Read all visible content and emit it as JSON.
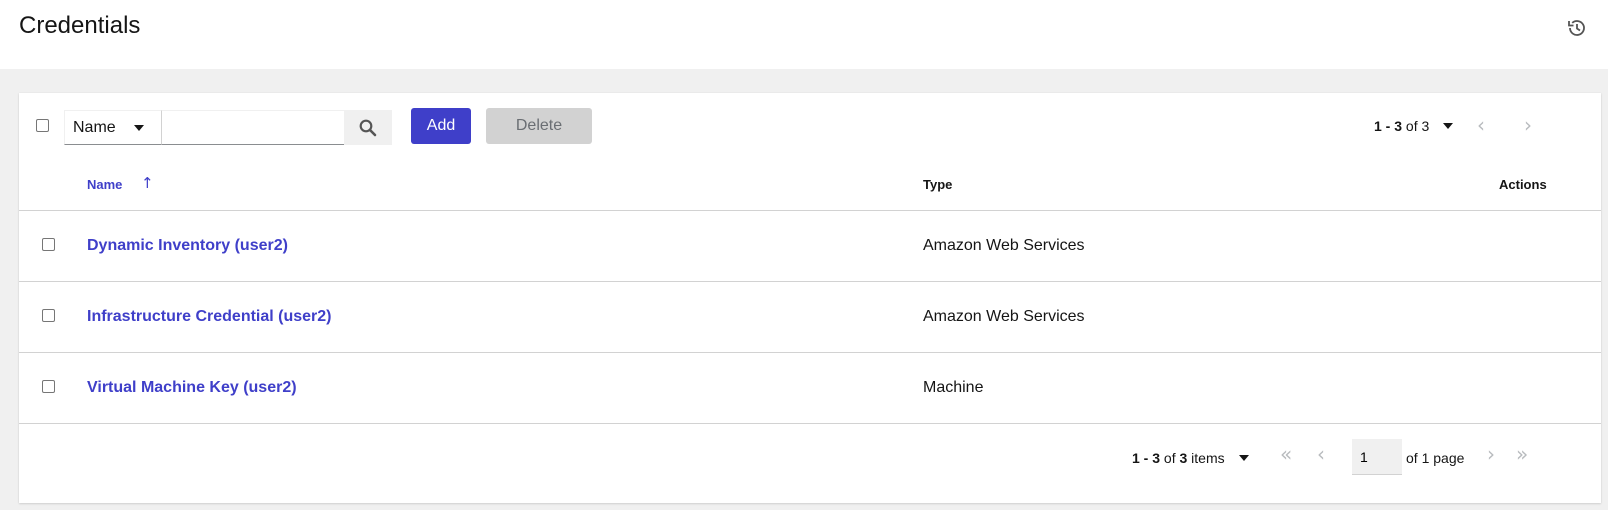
{
  "header": {
    "title": "Credentials",
    "history_icon": "history-icon"
  },
  "toolbar": {
    "filter_field": "Name",
    "search_value": "",
    "search_icon": "search-icon",
    "add_label": "Add",
    "delete_label": "Delete",
    "pagination": {
      "range": "1 - 3",
      "of_label": "of",
      "total": "3",
      "prev_icon": "chevron-left-icon",
      "next_icon": "chevron-right-icon"
    }
  },
  "table": {
    "columns": [
      {
        "label": "Name",
        "sort": "ascending",
        "sort_icon": "arrow-up-icon"
      },
      {
        "label": "Type"
      },
      {
        "label": "Actions"
      }
    ],
    "rows": [
      {
        "name": "Dynamic Inventory (user2)",
        "type": "Amazon Web Services"
      },
      {
        "name": "Infrastructure Credential (user2)",
        "type": "Amazon Web Services"
      },
      {
        "name": "Virtual Machine Key (user2)",
        "type": "Machine"
      }
    ]
  },
  "footer": {
    "range": "1 - 3",
    "of_label": "of",
    "total": "3",
    "items_label": "items",
    "page_value": "1",
    "of_pages": "of 1 page"
  },
  "colors": {
    "accent": "#3f3fc9",
    "disabled_button": "#d2d2d2",
    "page_background": "#f0f0f0"
  }
}
